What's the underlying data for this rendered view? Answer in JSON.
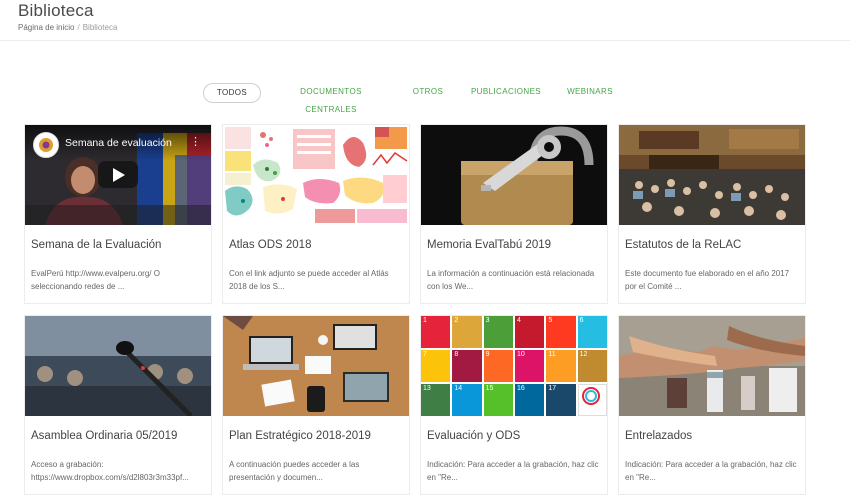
{
  "header": {
    "title": "Biblioteca",
    "breadcrumb": {
      "home": "Página de inicio",
      "separator": "/",
      "current": "Biblioteca"
    }
  },
  "filters": [
    {
      "label": "TODOS",
      "active": true
    },
    {
      "label": "DOCUMENTOS CENTRALES"
    },
    {
      "label": "OTROS"
    },
    {
      "label": "PUBLICACIONES"
    },
    {
      "label": "WEBINARS"
    }
  ],
  "cards": [
    {
      "title": "Semana de la Evaluación",
      "desc": "EvalPerú http://www.evalperu.org/ O seleccionando redes de ...",
      "video_title": "Semana de evaluación"
    },
    {
      "title": "Atlas ODS 2018",
      "desc": "Con el link adjunto se puede acceder al Atlás 2018 de los S..."
    },
    {
      "title": "Memoria EvalTabú 2019",
      "desc": "La información a continuación está relacionada con los We..."
    },
    {
      "title": "Estatutos de la ReLAC",
      "desc": "Este documento fue elaborado en el año 2017 por el Comité ..."
    },
    {
      "title": "Asamblea Ordinaria 05/2019",
      "desc": "Acceso a grabación: https://www.dropbox.com/s/d2l803r3m33pf..."
    },
    {
      "title": "Plan Estratégico 2018-2019",
      "desc": "A continuación puedes acceder a las presentación y documen..."
    },
    {
      "title": "Evaluación y ODS",
      "desc": "Indicación: Para acceder a la grabación, haz clic en \"Re..."
    },
    {
      "title": "Entrelazados",
      "desc": "Indicación: Para acceder a la grabación, haz clic en \"Re..."
    }
  ],
  "sdg_numbers": [
    "1",
    "2",
    "3",
    "4",
    "5",
    "6",
    "7",
    "8",
    "9",
    "10",
    "11",
    "12",
    "13",
    "14",
    "15",
    "16",
    "17",
    ""
  ],
  "colors": {
    "accent": "#47a546",
    "sdg": [
      "#e5243b",
      "#dda63a",
      "#4c9f38",
      "#c5192d",
      "#ff3a21",
      "#26bde2",
      "#fcc30b",
      "#a21942",
      "#fd6925",
      "#dd1367",
      "#fd9d24",
      "#bf8b2e",
      "#3f7e44",
      "#0a97d9",
      "#56c02b",
      "#00689d",
      "#19486a",
      "#ffffff"
    ]
  }
}
